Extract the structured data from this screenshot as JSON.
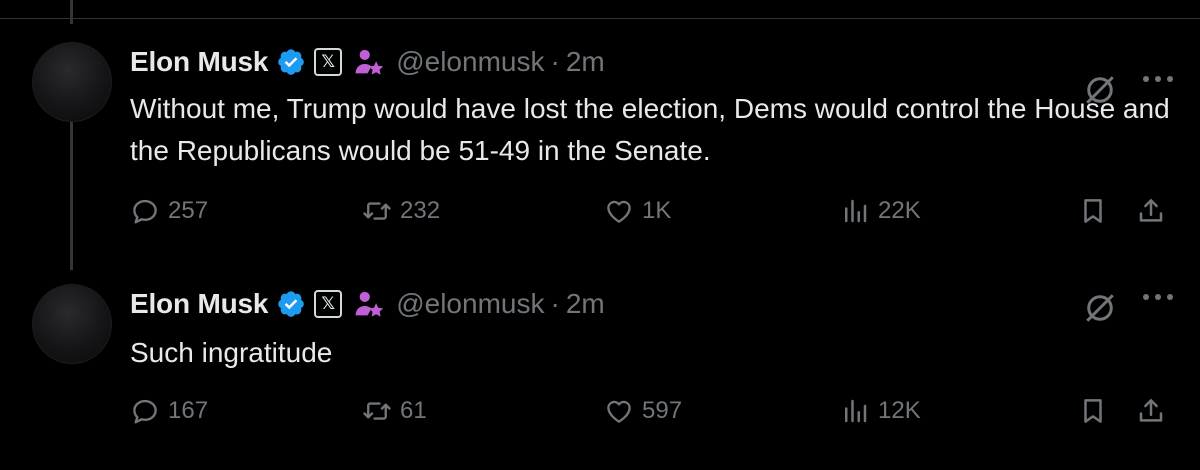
{
  "tweets": [
    {
      "name": "Elon Musk",
      "handle": "@elonmusk",
      "separator": "·",
      "time": "2m",
      "text": "Without me, Trump would have lost the election, Dems would control the House and the Republicans would be 51-49 in the Senate.",
      "stats": {
        "replies": "257",
        "reposts": "232",
        "likes": "1K",
        "views": "22K"
      }
    },
    {
      "name": "Elon Musk",
      "handle": "@elonmusk",
      "separator": "·",
      "time": "2m",
      "text": "Such ingratitude",
      "stats": {
        "replies": "167",
        "reposts": "61",
        "likes": "597",
        "views": "12K"
      }
    }
  ],
  "badges": {
    "x_label": "𝕏"
  },
  "colors": {
    "background": "#000000",
    "text": "#e7e9ea",
    "muted": "#71767b",
    "verified": "#1d9bf0",
    "affiliate": "#c05fd6"
  },
  "icons": [
    "verified-badge-icon",
    "x-badge-icon",
    "affiliate-icon",
    "grok-icon",
    "more-icon",
    "reply-icon",
    "repost-icon",
    "like-icon",
    "views-icon",
    "bookmark-icon",
    "share-icon"
  ]
}
